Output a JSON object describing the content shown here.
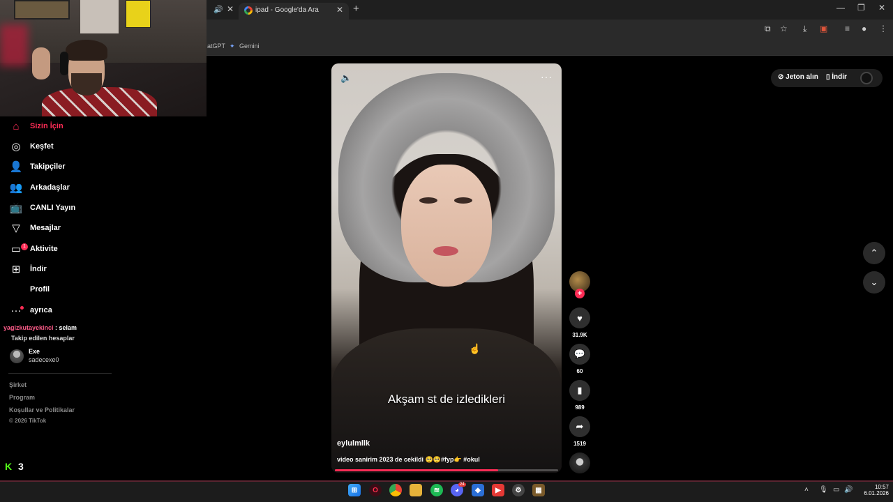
{
  "browser": {
    "tab_title": "ipad - Google'da Ara",
    "bookmarks": [
      "atGPT",
      "Gemini"
    ]
  },
  "sidebar": {
    "items": [
      {
        "label": "Sizin İçin",
        "icon": "home-icon"
      },
      {
        "label": "Keşfet",
        "icon": "compass-icon"
      },
      {
        "label": "Takipçiler",
        "icon": "followers-icon"
      },
      {
        "label": "Arkadaşlar",
        "icon": "friends-icon"
      },
      {
        "label": "CANLI Yayın",
        "icon": "live-icon"
      },
      {
        "label": "Mesajlar",
        "icon": "messages-icon"
      },
      {
        "label": "Aktivite",
        "icon": "activity-icon",
        "badge": "1"
      },
      {
        "label": "İndir",
        "icon": "download-icon"
      },
      {
        "label": "Profil",
        "icon": "profile-icon"
      },
      {
        "label": "ayrıca",
        "icon": "more-icon"
      }
    ],
    "chat_user": "yagizkutayekinci",
    "chat_message": " : selam",
    "followed_title": "Takip edilen hesaplar",
    "followed_account": {
      "name": "Exe",
      "handle": "sadecexe0"
    },
    "footer": [
      "Şirket",
      "Program",
      "Koşullar ve Politikalar"
    ],
    "copyright": "© 2026 TikTok"
  },
  "kick": {
    "logo": "K",
    "count": "3"
  },
  "topbar": {
    "coins": "Jeton alın",
    "download": "İndir"
  },
  "video": {
    "subtitle": "Akşam st de izledikleri",
    "author": "eylulmllk",
    "caption": "video sanirim 2023 de cekildi 🥺🥺#fyp👉 #okul",
    "progress": 0.73
  },
  "actions": {
    "likes": "31.9K",
    "comments": "60",
    "saves": "989",
    "shares": "1519"
  },
  "taskbar": {
    "time": "10:57",
    "date": "6.01.2026",
    "discord_badge": "24"
  },
  "colors": {
    "accent": "#fe2c55",
    "kick": "#53fc18"
  }
}
